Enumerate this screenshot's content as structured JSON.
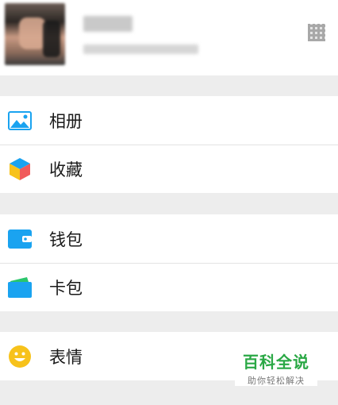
{
  "menu": {
    "album": "相册",
    "favorites": "收藏",
    "wallet": "钱包",
    "cards": "卡包",
    "stickers": "表情"
  },
  "watermark": {
    "title": "百科全说",
    "subtitle": "助你轻松解决"
  },
  "icons": {
    "album": "album-icon",
    "favorites": "favorites-cube-icon",
    "wallet": "wallet-icon",
    "cards": "card-holder-icon",
    "stickers": "smiley-icon",
    "profile_qr": "qr-code-icon"
  },
  "colors": {
    "background": "#ededed",
    "accent_blue": "#1aa3f0",
    "smiley_yellow": "#f7c21b",
    "watermark_green": "#2aa845"
  }
}
